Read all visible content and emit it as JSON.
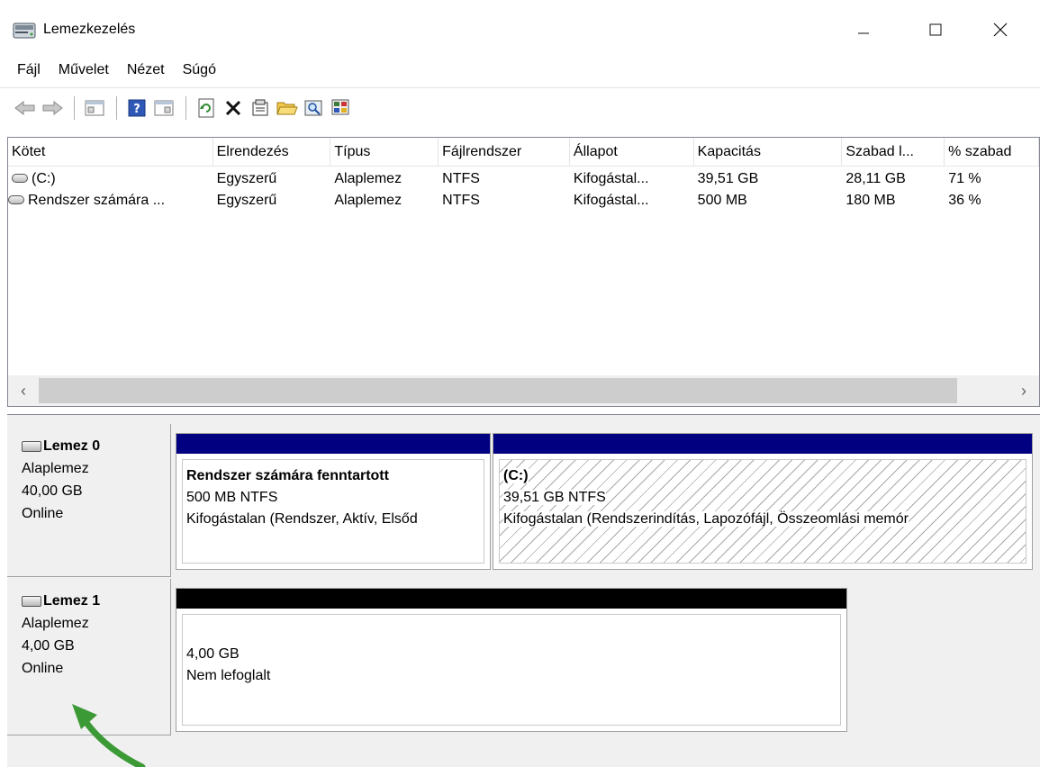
{
  "window": {
    "title": "Lemezkezelés"
  },
  "menu": [
    "Fájl",
    "Művelet",
    "Nézet",
    "Súgó"
  ],
  "table": {
    "columns": [
      "Kötet",
      "Elrendezés",
      "Típus",
      "Fájlrendszer",
      "Állapot",
      "Kapacitás",
      "Szabad l...",
      "% szabad"
    ],
    "rows": [
      [
        "(C:)",
        "Egyszerű",
        "Alaplemez",
        "NTFS",
        "Kifogástal...",
        "39,51 GB",
        "28,11 GB",
        "71 %"
      ],
      [
        "Rendszer számára ...",
        "Egyszerű",
        "Alaplemez",
        "NTFS",
        "Kifogástal...",
        "500 MB",
        "180 MB",
        "36 %"
      ]
    ]
  },
  "disks": [
    {
      "name": "Lemez 0",
      "type": "Alaplemez",
      "size": "40,00 GB",
      "status": "Online",
      "partitions": [
        {
          "name": "Rendszer számára fenntartott",
          "size": "500 MB NTFS",
          "health": "Kifogástalan (Rendszer, Aktív, Elsőd"
        },
        {
          "name": "(C:)",
          "size": "39,51 GB NTFS",
          "health": "Kifogástalan (Rendszerindítás, Lapozófájl, Összeomlási memór"
        }
      ]
    },
    {
      "name": "Lemez 1",
      "type": "Alaplemez",
      "size": "4,00 GB",
      "status": "Online",
      "partitions": [
        {
          "size": "4,00 GB",
          "health": "Nem lefoglalt"
        }
      ]
    }
  ],
  "colors": {
    "primary_partition_bar": "#000080",
    "unallocated_bar": "#000000",
    "arrow": "#3c9a36"
  }
}
